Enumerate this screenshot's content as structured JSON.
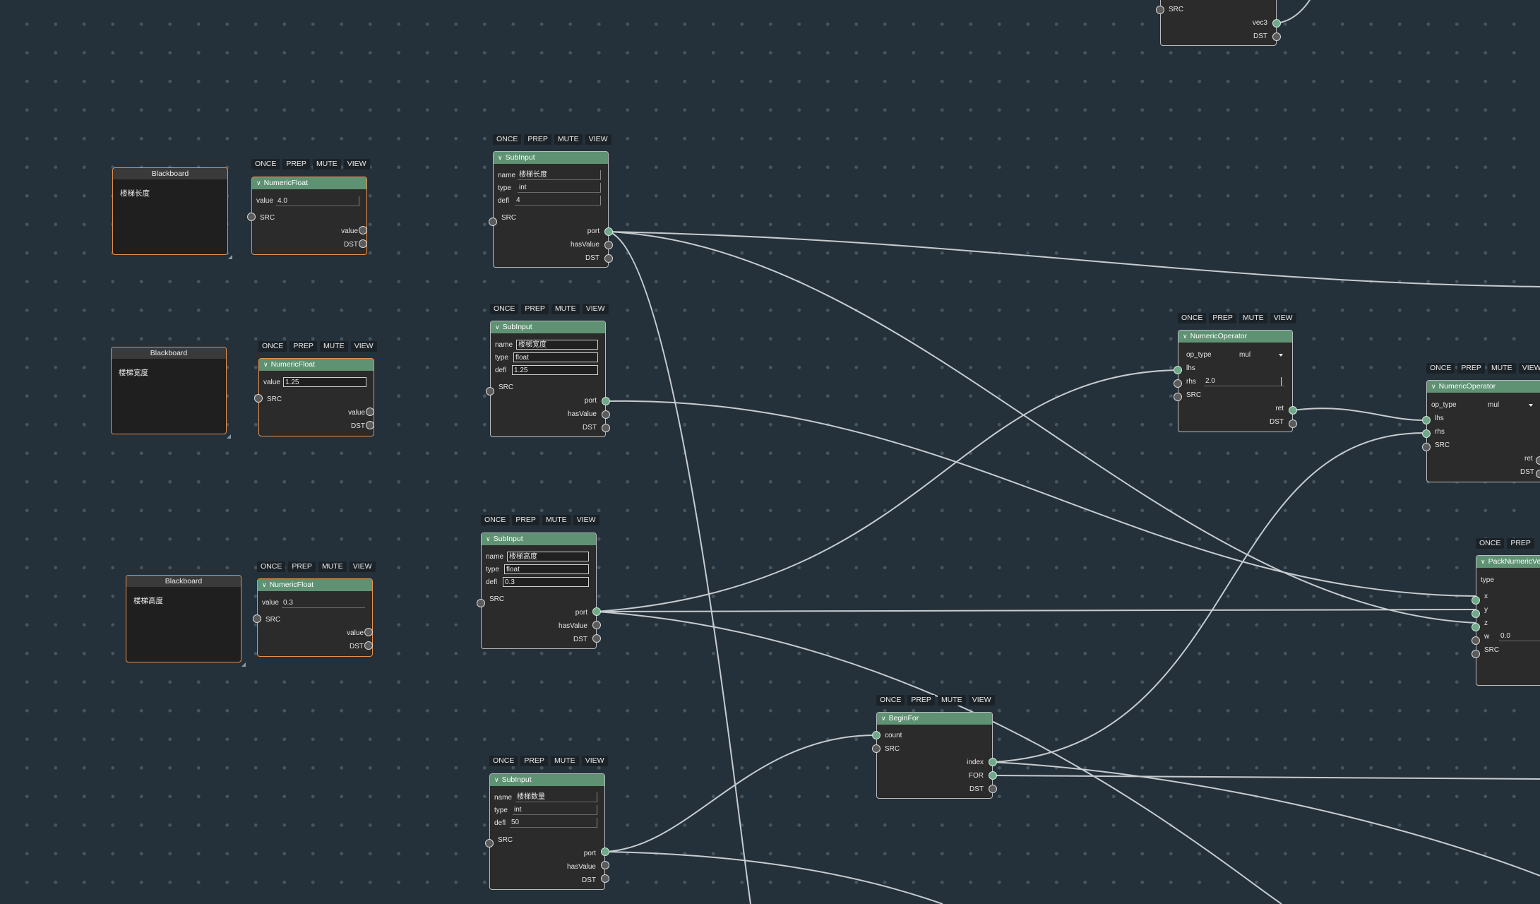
{
  "toolbar": {
    "once": "ONCE",
    "prep": "PREP",
    "mute": "MUTE",
    "view": "VIEW"
  },
  "common": {
    "src": "SRC",
    "dst": "DST",
    "port": "port",
    "hasValue": "hasValue",
    "value": "value",
    "name": "name",
    "type": "type",
    "defl": "defl"
  },
  "blackboards": [
    {
      "title": "Blackboard",
      "text": "楼梯长度"
    },
    {
      "title": "Blackboard",
      "text": "楼梯宽度"
    },
    {
      "title": "Blackboard",
      "text": "楼梯高度"
    }
  ],
  "numeric_floats": [
    {
      "title": "NumericFloat",
      "value": "4.0"
    },
    {
      "title": "NumericFloat",
      "value": "1.25"
    },
    {
      "title": "NumericFloat",
      "value": "0.3"
    }
  ],
  "sub_inputs": [
    {
      "title": "SubInput",
      "name": "楼梯长度",
      "type": "int",
      "defl": "4"
    },
    {
      "title": "SubInput",
      "name": "楼梯宽度",
      "type": "float",
      "defl": "1.25"
    },
    {
      "title": "SubInput",
      "name": "楼梯高度",
      "type": "float",
      "defl": "0.3"
    },
    {
      "title": "SubInput",
      "name": "楼梯数量",
      "type": "int",
      "defl": "50"
    }
  ],
  "numeric_operator_1": {
    "title": "NumericOperator",
    "op_type_label": "op_type",
    "op_type": "mul",
    "lhs": "lhs",
    "rhs": "rhs",
    "rhs_value": "2.0",
    "ret": "ret"
  },
  "numeric_operator_2": {
    "title": "NumericOperator",
    "op_type_label": "op_type",
    "op_type": "mul",
    "lhs": "lhs",
    "rhs": "rhs",
    "ret": "ret"
  },
  "pack_numeric_vec": {
    "title": "PackNumericVec",
    "type_label": "type",
    "x": "x",
    "y": "y",
    "z": "z",
    "w": "w",
    "w_value": "0.0"
  },
  "begin_for": {
    "title": "BeginFor",
    "count": "count",
    "index": "index",
    "for": "FOR"
  },
  "top_node": {
    "vec3": "vec3"
  },
  "colors": {
    "background": "#25313a",
    "node_header": "#5e9273",
    "node_body": "#2b2b2b",
    "blackboard_border": "#e8904c",
    "socket_active": "#6fa98a",
    "wire": "#c8cdd1"
  }
}
